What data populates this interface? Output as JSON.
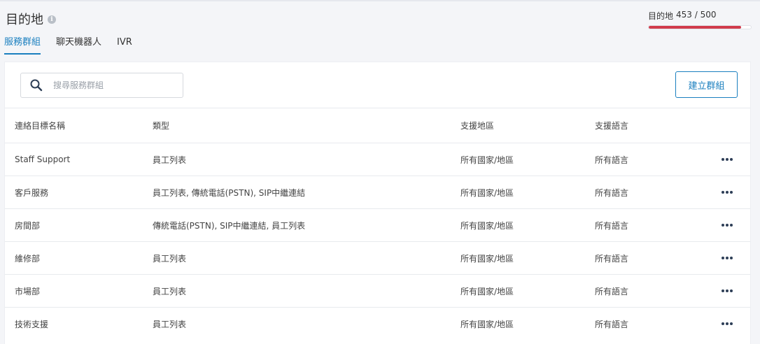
{
  "page": {
    "title": "目的地"
  },
  "quota": {
    "label": "目的地",
    "used": 453,
    "total": 500,
    "value": "453 / 500",
    "fill_fraction": 0.906,
    "bar_color": "#d13b4c"
  },
  "tabs": [
    {
      "label": "服務群組",
      "active": true
    },
    {
      "label": "聊天機器人",
      "active": false
    },
    {
      "label": "IVR",
      "active": false
    }
  ],
  "search": {
    "placeholder": "搜尋服務群組",
    "value": ""
  },
  "create_button": {
    "label": "建立群組"
  },
  "table": {
    "columns": [
      "連絡目標名稱",
      "類型",
      "支援地區",
      "支援語言"
    ],
    "rows": [
      {
        "name": "Staff Support",
        "type": "員工列表",
        "region": "所有國家/地區",
        "language": "所有語言"
      },
      {
        "name": "客戶服務",
        "type": "員工列表, 傳統電話(PSTN), SIP中繼連結",
        "region": "所有國家/地區",
        "language": "所有語言"
      },
      {
        "name": "房間部",
        "type": "傳統電話(PSTN), SIP中繼連結, 員工列表",
        "region": "所有國家/地區",
        "language": "所有語言"
      },
      {
        "name": "維修部",
        "type": "員工列表",
        "region": "所有國家/地區",
        "language": "所有語言"
      },
      {
        "name": "市場部",
        "type": "員工列表",
        "region": "所有國家/地區",
        "language": "所有語言"
      },
      {
        "name": "技術支援",
        "type": "員工列表",
        "region": "所有國家/地區",
        "language": "所有語言"
      }
    ]
  },
  "colors": {
    "accent": "#1a7fbf",
    "quota_bar": "#d13b4c",
    "background": "#f4f5f8"
  }
}
